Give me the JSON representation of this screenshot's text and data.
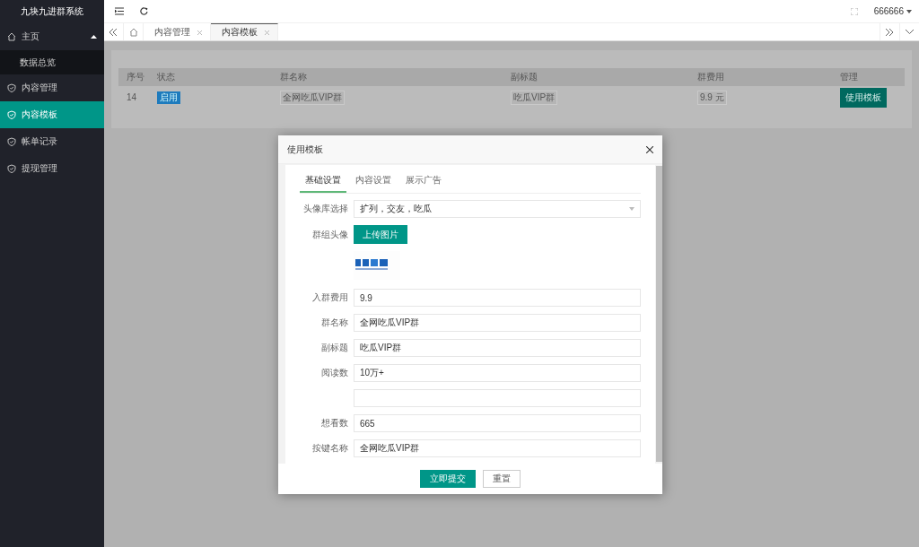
{
  "app": {
    "title": "九块九进群系统"
  },
  "sidebar": {
    "items": [
      {
        "label": "主页",
        "expanded": true,
        "selected": false,
        "children": [
          {
            "label": "数据总览",
            "selected": false
          }
        ]
      },
      {
        "label": "内容管理",
        "selected": false
      },
      {
        "label": "内容模板",
        "selected": true
      },
      {
        "label": "帐单记录",
        "selected": false
      },
      {
        "label": "提现管理",
        "selected": false
      }
    ]
  },
  "header": {
    "user": "666666"
  },
  "tabs": [
    {
      "label": "内容管理",
      "selected": false
    },
    {
      "label": "内容模板",
      "selected": true
    }
  ],
  "table": {
    "columns": [
      "序号",
      "状态",
      "群名称",
      "副标题",
      "群费用",
      "管理"
    ],
    "rows": [
      {
        "id": "14",
        "status": "启用",
        "name": "全网吃瓜VIP群",
        "subtitle": "吃瓜VIP群",
        "fee": "9.9 元",
        "action": "使用模板"
      }
    ]
  },
  "dialog": {
    "title": "使用模板",
    "tabs": [
      {
        "label": "基础设置",
        "selected": true
      },
      {
        "label": "内容设置",
        "selected": false
      },
      {
        "label": "展示广告",
        "selected": false
      }
    ],
    "fields": [
      {
        "kind": "select",
        "label": "头像库选择",
        "value": "扩列，交友，吃瓜"
      },
      {
        "kind": "upload",
        "label": "群组头像",
        "button": "上传图片"
      },
      {
        "kind": "picture"
      },
      {
        "kind": "input",
        "label": "入群费用",
        "value": "9.9"
      },
      {
        "kind": "input",
        "label": "群名称",
        "value": "全网吃瓜VIP群"
      },
      {
        "kind": "input",
        "label": "副标题",
        "value": "吃瓜VIP群"
      },
      {
        "kind": "input",
        "label": "阅读数",
        "value": "10万+"
      },
      {
        "kind": "input"
      },
      {
        "kind": "input",
        "label": "想看数",
        "value": "665"
      },
      {
        "kind": "input",
        "label": "按键名称",
        "value": "全网吃瓜VIP群"
      }
    ],
    "buttons": [
      {
        "label": "立即提交",
        "primary": true
      },
      {
        "label": "重置",
        "primary": false
      }
    ]
  }
}
